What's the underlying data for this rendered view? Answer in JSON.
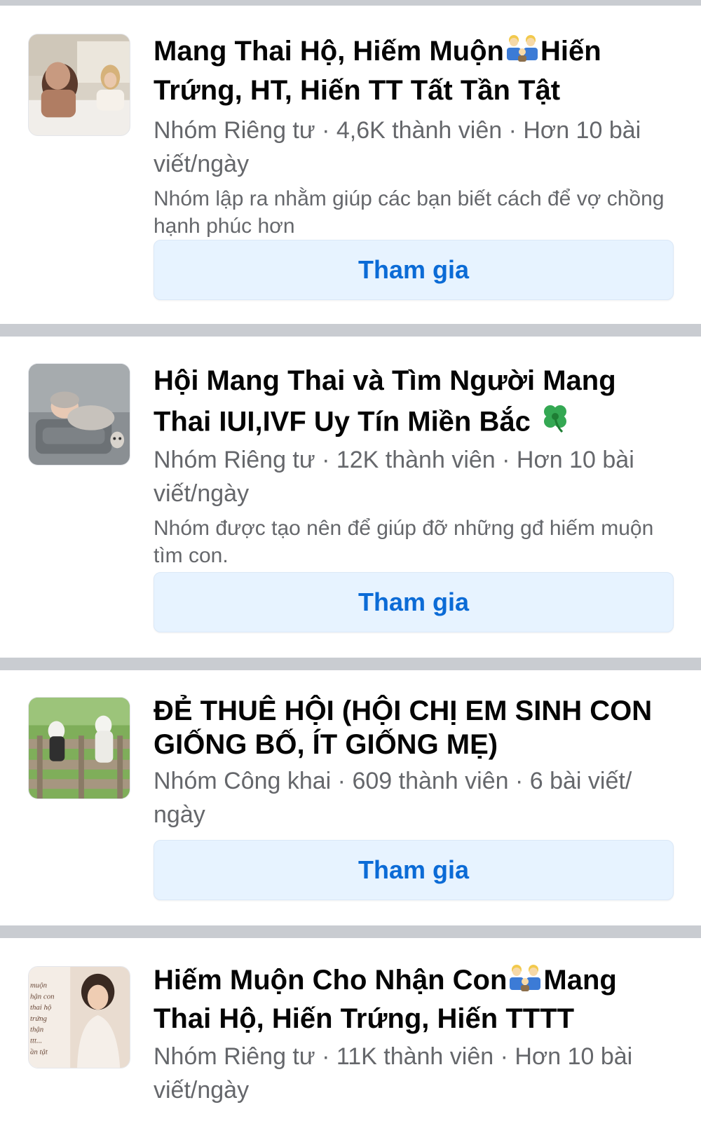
{
  "groups": [
    {
      "title_part1": "Mang Thai Hộ, Hiếm Muộn",
      "title_part2": "Hiến Trứng, HT, Hiến TT Tất Tần Tật",
      "meta": "Nhóm Riêng tư · 4,6K thành viên · Hơn 10 bài viết/ngày",
      "description": "Nhóm lập ra nhằm giúp các bạn biết cách để vợ chồng hạnh phúc hơn",
      "join_label": "Tham gia",
      "icon": "family-emoji"
    },
    {
      "title_part1": "Hội Mang Thai và Tìm Người Mang Thai IUI,IVF Uy Tín Miền Bắc",
      "meta": "Nhóm Riêng tư · 12K thành viên · Hơn 10 bài viết/ngày",
      "description": "Nhóm được tạo nên để giúp đỡ những gđ hiếm muộn tìm con.",
      "join_label": "Tham gia",
      "icon": "four-leaf-clover-emoji"
    },
    {
      "title_part1": "ĐẺ THUÊ HỘI (HỘI CHỊ EM SINH CON GIỐNG BỐ, ÍT GIỐNG MẸ)",
      "meta": "Nhóm Công khai · 609 thành viên · 6 bài viết/ ngày",
      "join_label": "Tham gia"
    },
    {
      "title_part1": "Hiếm Muộn Cho Nhận Con",
      "title_part2": "Mang Thai Hộ, Hiến Trứng, Hiến TTTT",
      "meta": "Nhóm Riêng tư · 11K thành viên · Hơn 10 bài viết/ngày",
      "icon": "family-emoji",
      "thumb_text": [
        "muộn",
        "hận con",
        "thai hộ",
        "trứng",
        "thận",
        "ttt...",
        "ần tật"
      ]
    }
  ],
  "colors": {
    "divider": "#c9ccd1",
    "button_bg": "#e7f3ff",
    "button_text": "#0b6bd6",
    "meta_text": "#65676b"
  }
}
